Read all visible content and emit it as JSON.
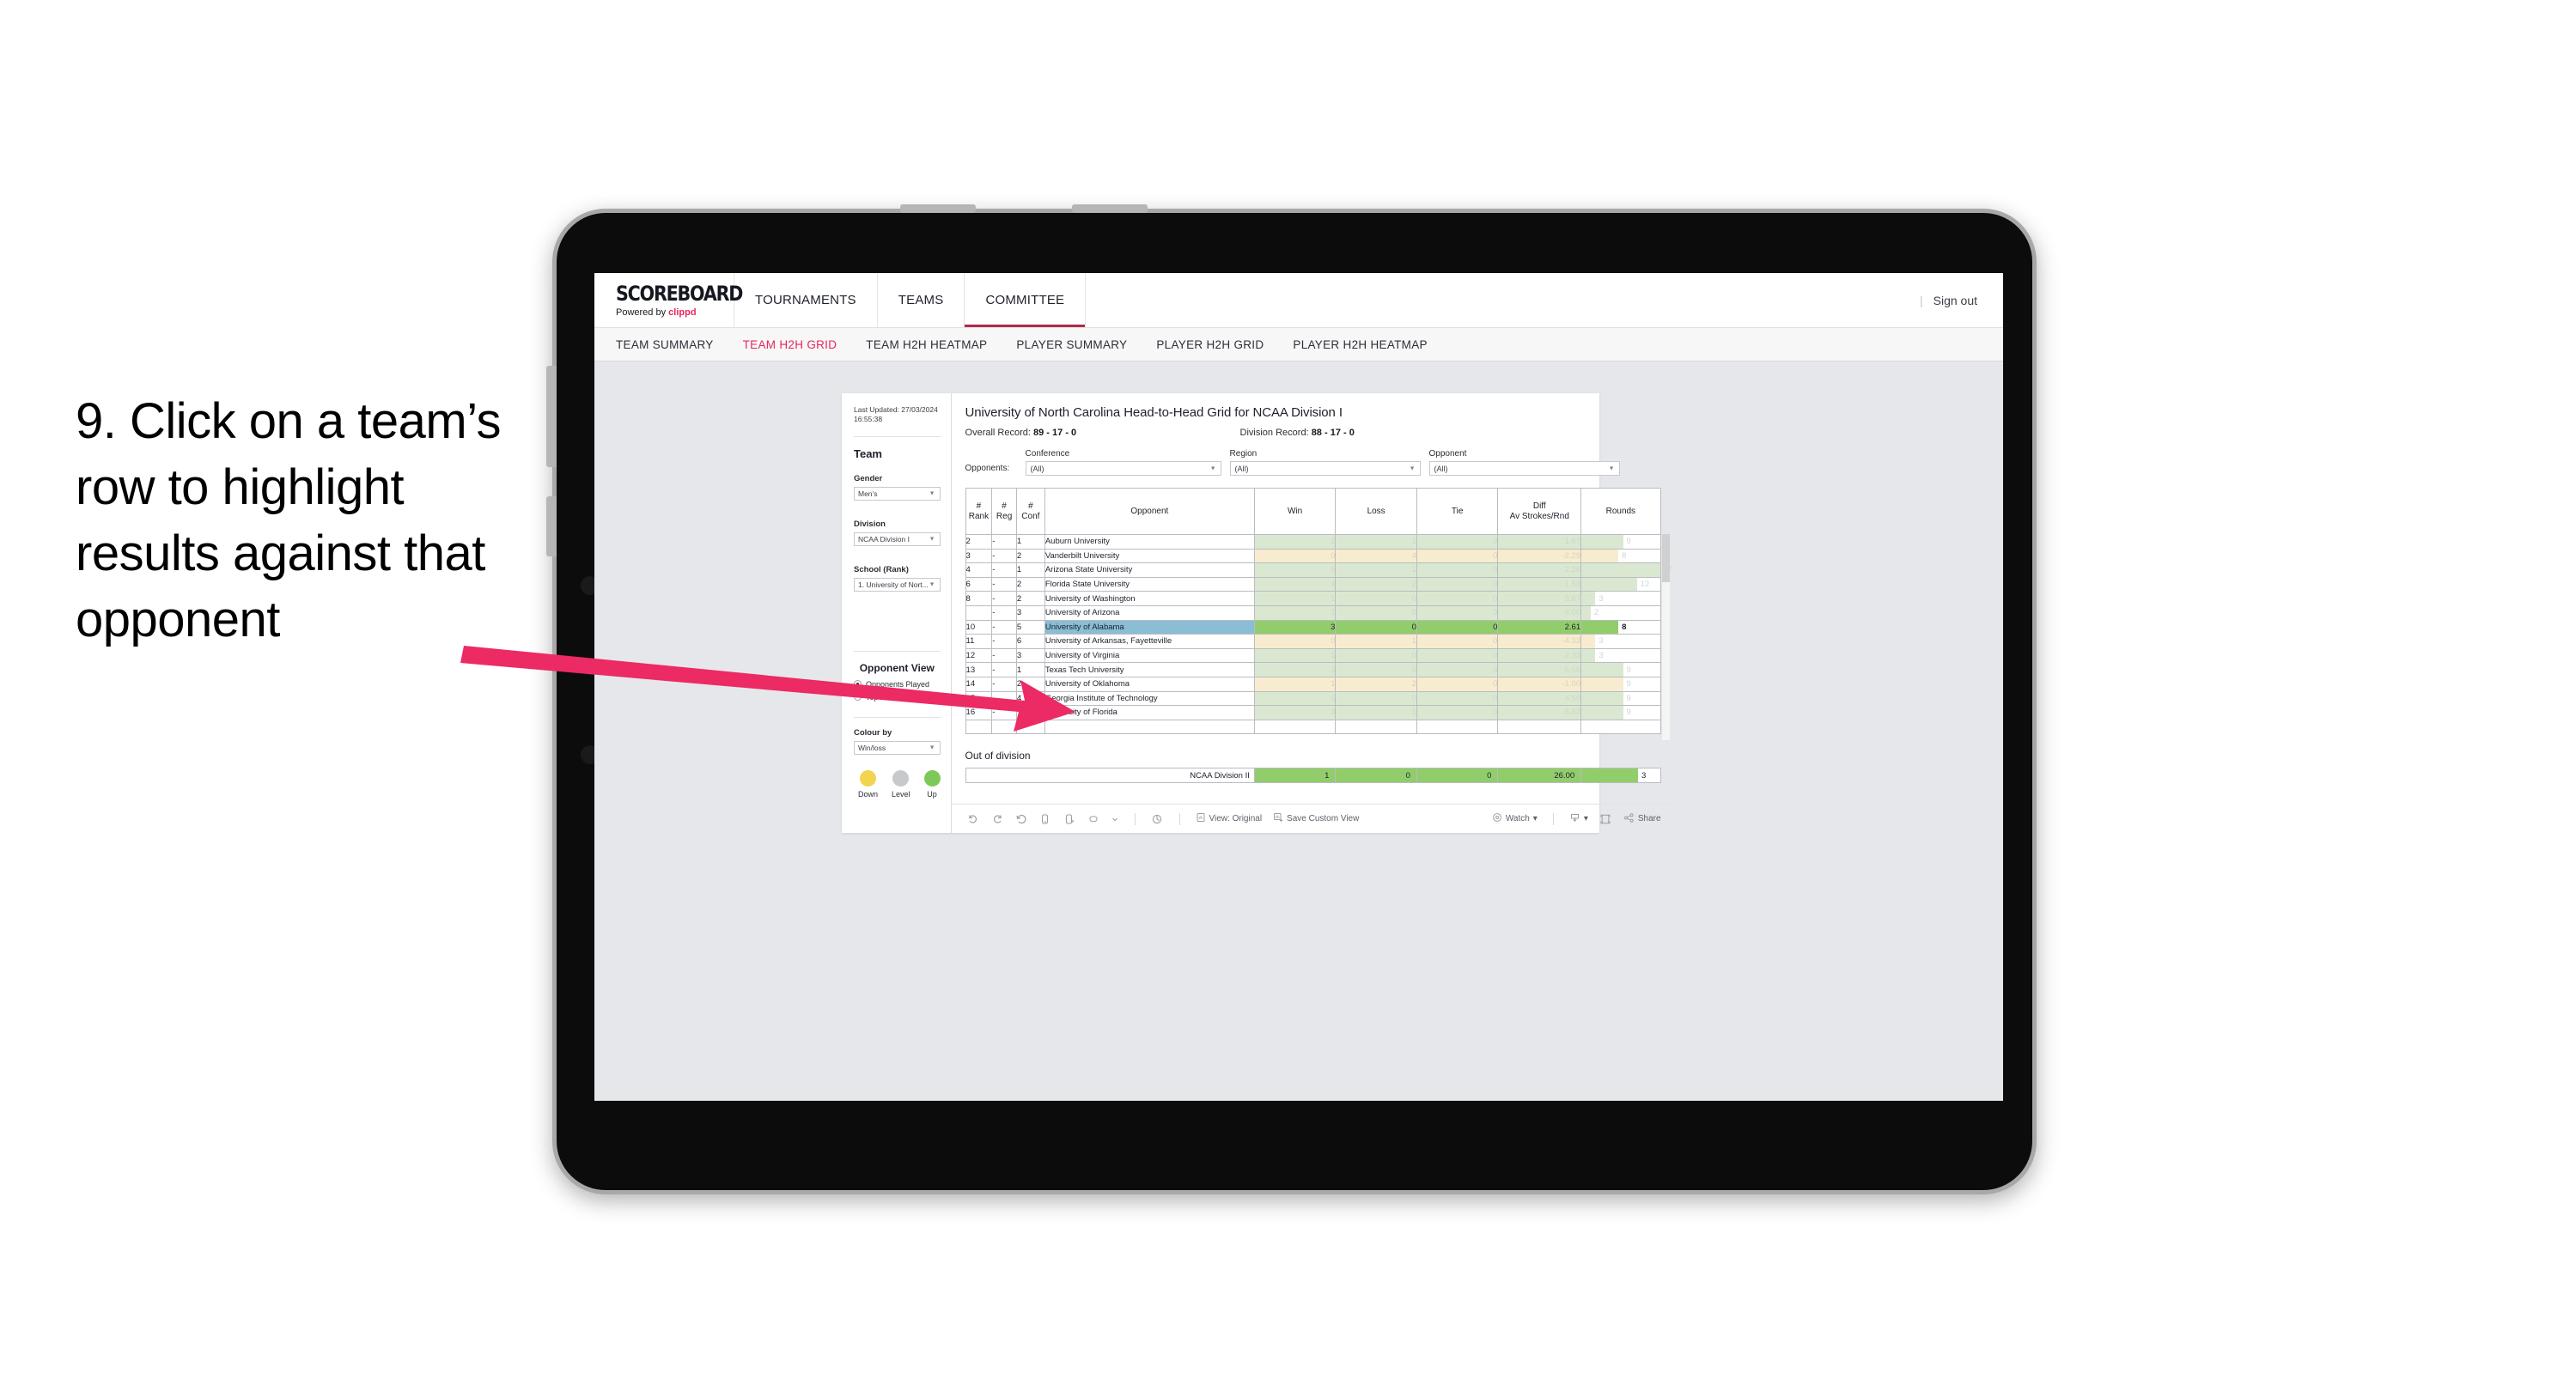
{
  "caption": "9. Click on a team’s row to highlight results against that opponent",
  "accent": "#e8265c",
  "topbar": {
    "brand_title": "SCOREBOARD",
    "brand_sub_prefix": "Powered by ",
    "brand_sub_name": "clippd",
    "nav": [
      {
        "label": "TOURNAMENTS",
        "active": false
      },
      {
        "label": "TEAMS",
        "active": false
      },
      {
        "label": "COMMITTEE",
        "active": true
      }
    ],
    "divider": "|",
    "signout": "Sign out"
  },
  "subnav": [
    {
      "label": "TEAM SUMMARY",
      "active": false
    },
    {
      "label": "TEAM H2H GRID",
      "active": true
    },
    {
      "label": "TEAM H2H HEATMAP",
      "active": false
    },
    {
      "label": "PLAYER SUMMARY",
      "active": false
    },
    {
      "label": "PLAYER H2H GRID",
      "active": false
    },
    {
      "label": "PLAYER H2H HEATMAP",
      "active": false
    }
  ],
  "sidebar": {
    "last_updated": "Last Updated: 27/03/2024 16:55:38",
    "team_heading": "Team",
    "gender_label": "Gender",
    "gender_value": "Men’s",
    "division_label": "Division",
    "division_value": "NCAA Division I",
    "school_label": "School (Rank)",
    "school_value": "1. University of Nort...",
    "opponent_view_heading": "Opponent View",
    "radio_options": [
      {
        "label": "Opponents Played",
        "selected": true
      },
      {
        "label": "Top 100",
        "selected": false
      }
    ],
    "colour_by_label": "Colour by",
    "colour_by_value": "Win/loss",
    "legend": [
      {
        "label": "Down",
        "color": "#f2d44e"
      },
      {
        "label": "Level",
        "color": "#c8c9cb"
      },
      {
        "label": "Up",
        "color": "#7ec85a"
      }
    ]
  },
  "viz": {
    "title": "University of North Carolina Head-to-Head Grid for NCAA Division I",
    "overall_record_label": "Overall Record:",
    "overall_record_value": "89 - 17 - 0",
    "division_record_label": "Division Record:",
    "division_record_value": "88 - 17 - 0",
    "opponents_label": "Opponents:",
    "filters": [
      {
        "label": "Conference",
        "value": "(All)"
      },
      {
        "label": "Region",
        "value": "(All)"
      },
      {
        "label": "Opponent",
        "value": "(All)"
      }
    ],
    "out_of_division_title": "Out of division"
  },
  "chart_data": {
    "type": "table",
    "title": "University of North Carolina Head-to-Head Grid for NCAA Division I",
    "columns": [
      "# Rank",
      "# Reg",
      "# Conf",
      "Opponent",
      "Win",
      "Loss",
      "Tie",
      "Diff Av Strokes/Rnd",
      "Rounds"
    ],
    "rounds_max": 17,
    "colors": {
      "up": "#dbe8d1",
      "down": "#f7ecd0",
      "up_strong": "#92cd6b",
      "highlight_row": "#8bbdd4",
      "rounds_bar_up": "#dbe8d1",
      "rounds_bar_down": "#f7ecd0"
    },
    "rows": [
      {
        "rank": "2",
        "reg": "-",
        "conf": "1",
        "opponent": "Auburn University",
        "win": "2",
        "loss": "1",
        "tie": "0",
        "diff": "1.67",
        "rounds": "9",
        "result": "up",
        "highlight": false
      },
      {
        "rank": "3",
        "reg": "-",
        "conf": "2",
        "opponent": "Vanderbilt University",
        "win": "0",
        "loss": "4",
        "tie": "0",
        "diff": "-2.29",
        "rounds": "8",
        "result": "down",
        "highlight": false
      },
      {
        "rank": "4",
        "reg": "-",
        "conf": "1",
        "opponent": "Arizona State University",
        "win": "5",
        "loss": "1",
        "tie": "0",
        "diff": "2.28",
        "rounds": "17",
        "result": "up",
        "highlight": false
      },
      {
        "rank": "6",
        "reg": "-",
        "conf": "2",
        "opponent": "Florida State University",
        "win": "4",
        "loss": "2",
        "tie": "0",
        "diff": "1.83",
        "rounds": "12",
        "result": "up",
        "highlight": false
      },
      {
        "rank": "8",
        "reg": "-",
        "conf": "2",
        "opponent": "University of Washington",
        "win": "1",
        "loss": "0",
        "tie": "0",
        "diff": "3.67",
        "rounds": "3",
        "result": "up",
        "highlight": false
      },
      {
        "rank": "",
        "reg": "-",
        "conf": "3",
        "opponent": "University of Arizona",
        "win": "1",
        "loss": "0",
        "tie": "0",
        "diff": "9.00",
        "rounds": "2",
        "result": "up",
        "highlight": false
      },
      {
        "rank": "10",
        "reg": "-",
        "conf": "5",
        "opponent": "University of Alabama",
        "win": "3",
        "loss": "0",
        "tie": "0",
        "diff": "2.61",
        "rounds": "8",
        "result": "up",
        "highlight": true
      },
      {
        "rank": "11",
        "reg": "-",
        "conf": "6",
        "opponent": "University of Arkansas, Fayetteville",
        "win": "0",
        "loss": "1",
        "tie": "0",
        "diff": "-4.33",
        "rounds": "3",
        "result": "down",
        "highlight": false
      },
      {
        "rank": "12",
        "reg": "-",
        "conf": "3",
        "opponent": "University of Virginia",
        "win": "1",
        "loss": "0",
        "tie": "0",
        "diff": "2.33",
        "rounds": "3",
        "result": "up",
        "highlight": false
      },
      {
        "rank": "13",
        "reg": "-",
        "conf": "1",
        "opponent": "Texas Tech University",
        "win": "3",
        "loss": "0",
        "tie": "0",
        "diff": "5.56",
        "rounds": "9",
        "result": "up",
        "highlight": false
      },
      {
        "rank": "14",
        "reg": "-",
        "conf": "2",
        "opponent": "University of Oklahoma",
        "win": "1",
        "loss": "2",
        "tie": "0",
        "diff": "-1.00",
        "rounds": "9",
        "result": "down",
        "highlight": false
      },
      {
        "rank": "15",
        "reg": "-",
        "conf": "4",
        "opponent": "Georgia Institute of Technology",
        "win": "5",
        "loss": "0",
        "tie": "0",
        "diff": "4.50",
        "rounds": "9",
        "result": "up",
        "highlight": false
      },
      {
        "rank": "16",
        "reg": "-",
        "conf": "7",
        "opponent": "University of Florida",
        "win": "3",
        "loss": "1",
        "tie": "0",
        "diff": "6.62",
        "rounds": "9",
        "result": "up",
        "highlight": false
      }
    ],
    "out_of_division": [
      {
        "label": "NCAA Division II",
        "win": "1",
        "loss": "0",
        "tie": "0",
        "diff": "26.00",
        "rounds": "3",
        "result": "up_strong"
      }
    ]
  },
  "toolbar": {
    "view_label": "View: Original",
    "save_label": "Save Custom View",
    "watch_label": "Watch",
    "share_label": "Share"
  }
}
